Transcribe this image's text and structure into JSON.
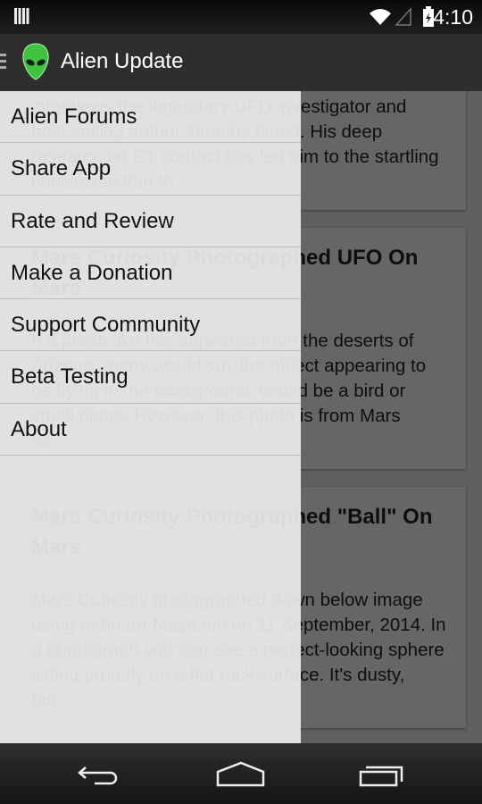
{
  "status_bar": {
    "time": "4:10",
    "icons": [
      "notification-icon",
      "wifi-icon",
      "signal-icon",
      "battery-charging-icon"
    ]
  },
  "action_bar": {
    "title": "Alien Update",
    "icons": [
      "menu-icon",
      "alien-logo-icon"
    ]
  },
  "feed": [
    {
      "title": "",
      "date": "",
      "body": "interviews the legendary UFO investigator and best-selling author Timothy Good. His deep research on ET contact has led him to the startling conclusion that th..."
    },
    {
      "title": "Mars Curiosity Photographed UFO On Mars",
      "date": "2014-09-26 03:58:02",
      "body": "If a photo like this appeared from the deserts of Arizona, many would say the object appearing to be flying in the background, would be a bird or small plane. However, this photo is from Mars as......"
    },
    {
      "title": "Mars Curiosity Photographed \"Ball\" On Mars",
      "date": "2014-09-26 03:54:04",
      "body": "Mars Curiosity photographed down below image using onboard Mastcam on 11 September, 2014. In a photograph you can see a perfect-looking sphere sitting proudly on a flat rock surface. It's dusty, but...."
    }
  ],
  "drawer": {
    "items": [
      {
        "label": "Alien Forums"
      },
      {
        "label": "Share App"
      },
      {
        "label": "Rate and Review"
      },
      {
        "label": "Make a Donation"
      },
      {
        "label": "Support Community"
      },
      {
        "label": "Beta Testing"
      },
      {
        "label": "About"
      }
    ]
  },
  "nav_bar": {
    "icons": [
      "back-icon",
      "home-icon",
      "recent-apps-icon"
    ]
  },
  "colors": {
    "logo_green": "#3ec43e",
    "action_bar": "#2e2e2e"
  }
}
